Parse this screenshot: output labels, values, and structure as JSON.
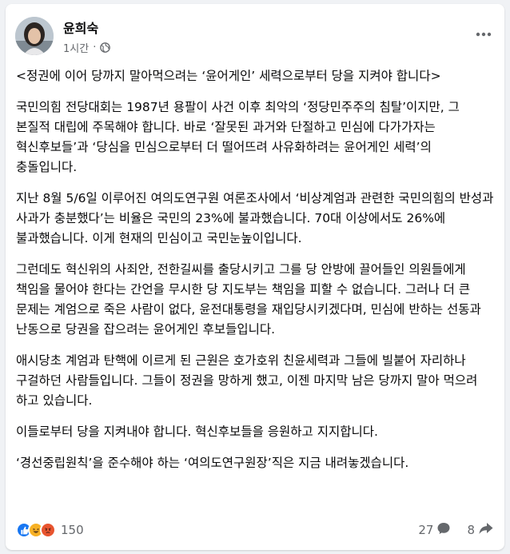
{
  "post": {
    "author": "윤희숙",
    "time": "1시간",
    "separator": "·",
    "paragraphs": [
      "<정권에 이어 당까지 말아먹으려는 ‘윤어게인’ 세력으로부터 당을 지켜야 합니다>",
      "국민의힘 전당대회는 1987년 용팔이 사건 이후 최악의 ‘정당민주주의 침탈’이지만, 그 본질적 대립에 주목해야 합니다. 바로 ‘잘못된 과거와 단절하고 민심에 다가가자는 혁신후보들’과 ‘당심을 민심으로부터 더 떨어뜨려 사유화하려는 윤어게인 세력’의 충돌입니다.",
      "지난 8월 5/6일 이루어진 여의도연구원 여론조사에서 ‘비상계엄과 관련한 국민의힘의 반성과 사과가 충분했다’는 비율은 국민의 23%에 불과했습니다. 70대 이상에서도 26%에 불과했습니다. 이게 현재의 민심이고 국민눈높이입니다.",
      "그런데도 혁신위의 사죄안, 전한길씨를 출당시키고 그를 당 안방에 끌어들인 의원들에게 책임을 물어야 한다는 간언을 무시한 당 지도부는 책임을 피할 수 없습니다. 그러나 더 큰 문제는 계엄으로 죽은 사람이 없다, 윤전대통령을 재입당시키겠다며, 민심에 반하는 선동과 난동으로 당권을 잡으려는 윤어게인 후보들입니다.",
      "애시당초 계엄과 탄핵에 이르게 된 근원은 호가호위 친윤세력과 그들에 빌붙어 자리하나 구걸하던 사람들입니다. 그들이 정권을 망하게 했고, 이젠 마지막 남은 당까지 말아 먹으려 하고 있습니다.",
      "이들로부터 당을 지켜내야 합니다. 혁신후보들을 응원하고 지지합니다.",
      "‘경선중립원칙’을 준수해야 하는 ‘여의도연구원장’직은 지금 내려놓겠습니다."
    ]
  },
  "footer": {
    "reaction_count": "150",
    "comment_count": "27",
    "share_count": "8"
  },
  "icons": {
    "avatar": "profile-photo",
    "privacy": "globe-icon",
    "more": "more-horizontal-icon",
    "reactions": [
      "like-icon",
      "haha-icon",
      "angry-icon"
    ],
    "comment": "comment-icon",
    "share": "share-icon"
  },
  "colors": {
    "like": "#1877f2",
    "haha": "#f7b125",
    "angry": "#e8542f",
    "meta": "#65686c"
  }
}
